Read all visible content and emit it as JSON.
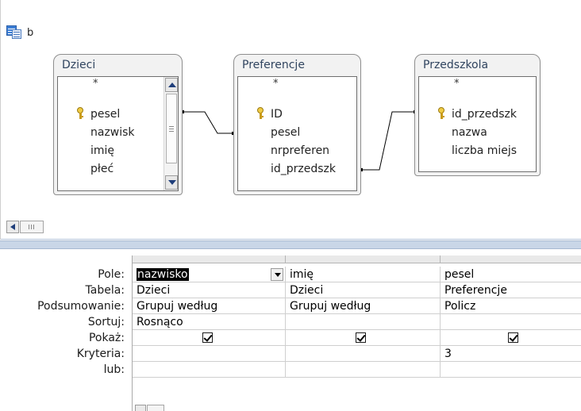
{
  "window": {
    "title": "b",
    "icon": "query-icon"
  },
  "tables": [
    {
      "name": "Dzieci",
      "star": "*",
      "fields": [
        "pesel",
        "nazwisk",
        "imię",
        "płeć"
      ],
      "key_field": "pesel",
      "has_scrollbar": true
    },
    {
      "name": "Preferencje",
      "star": "*",
      "fields": [
        "ID",
        "pesel",
        "nrpreferen",
        "id_przedszk"
      ],
      "key_field": "ID",
      "has_scrollbar": false
    },
    {
      "name": "Przedszkola",
      "star": "*",
      "fields": [
        "id_przedszk",
        "nazwa",
        "liczba miejs"
      ],
      "key_field": "id_przedszk",
      "has_scrollbar": false
    }
  ],
  "row_labels": [
    "Pole:",
    "Tabela:",
    "Podsumowanie:",
    "Sortuj:",
    "Pokaż:",
    "Kryteria:",
    "lub:"
  ],
  "columns": [
    {
      "pole": "nazwisko",
      "tabela": "Dzieci",
      "podsumowanie": "Grupuj według",
      "sortuj": "Rosnąco",
      "pokaz": true,
      "kryteria": "",
      "lub": ""
    },
    {
      "pole": "imię",
      "tabela": "Dzieci",
      "podsumowanie": "Grupuj według",
      "sortuj": "",
      "pokaz": true,
      "kryteria": "",
      "lub": ""
    },
    {
      "pole": "pesel",
      "tabela": "Preferencje",
      "podsumowanie": "Policz",
      "sortuj": "",
      "pokaz": true,
      "kryteria": "3",
      "lub": ""
    }
  ],
  "colors": {
    "selection": "#000000",
    "splitter": "#c9d6e7",
    "table_title": "#30445f"
  }
}
